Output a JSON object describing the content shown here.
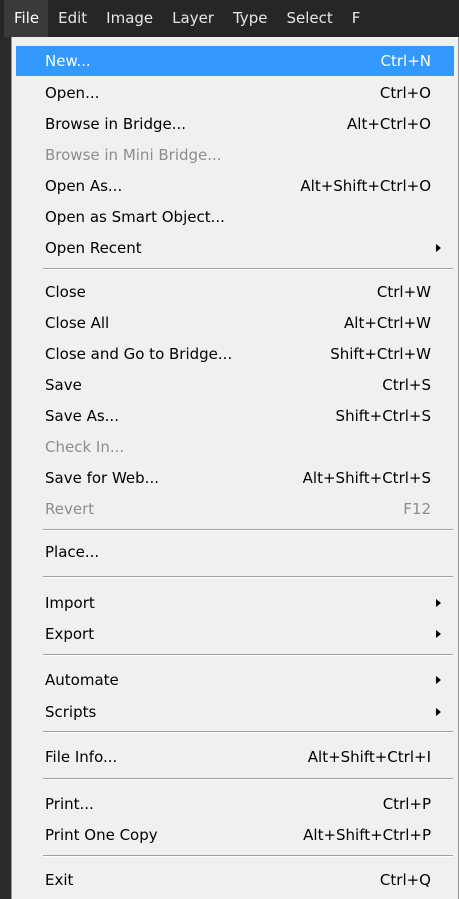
{
  "menubar": {
    "items": [
      {
        "label": "File",
        "active": true
      },
      {
        "label": "Edit"
      },
      {
        "label": "Image"
      },
      {
        "label": "Layer"
      },
      {
        "label": "Type"
      },
      {
        "label": "Select"
      },
      {
        "label": "F"
      }
    ]
  },
  "file_menu": {
    "new": {
      "label": "New...",
      "shortcut": "Ctrl+N"
    },
    "open": {
      "label": "Open...",
      "shortcut": "Ctrl+O"
    },
    "browse_bridge": {
      "label": "Browse in Bridge...",
      "shortcut": "Alt+Ctrl+O"
    },
    "browse_mini_bridge": {
      "label": "Browse in Mini Bridge...",
      "shortcut": ""
    },
    "open_as": {
      "label": "Open As...",
      "shortcut": "Alt+Shift+Ctrl+O"
    },
    "open_smart_object": {
      "label": "Open as Smart Object...",
      "shortcut": ""
    },
    "open_recent": {
      "label": "Open Recent",
      "shortcut": ""
    },
    "close": {
      "label": "Close",
      "shortcut": "Ctrl+W"
    },
    "close_all": {
      "label": "Close All",
      "shortcut": "Alt+Ctrl+W"
    },
    "close_go_bridge": {
      "label": "Close and Go to Bridge...",
      "shortcut": "Shift+Ctrl+W"
    },
    "save": {
      "label": "Save",
      "shortcut": "Ctrl+S"
    },
    "save_as": {
      "label": "Save As...",
      "shortcut": "Shift+Ctrl+S"
    },
    "check_in": {
      "label": "Check In...",
      "shortcut": ""
    },
    "save_for_web": {
      "label": "Save for Web...",
      "shortcut": "Alt+Shift+Ctrl+S"
    },
    "revert": {
      "label": "Revert",
      "shortcut": "F12"
    },
    "place": {
      "label": "Place...",
      "shortcut": ""
    },
    "import": {
      "label": "Import",
      "shortcut": ""
    },
    "export": {
      "label": "Export",
      "shortcut": ""
    },
    "automate": {
      "label": "Automate",
      "shortcut": ""
    },
    "scripts": {
      "label": "Scripts",
      "shortcut": ""
    },
    "file_info": {
      "label": "File Info...",
      "shortcut": "Alt+Shift+Ctrl+I"
    },
    "print": {
      "label": "Print...",
      "shortcut": "Ctrl+P"
    },
    "print_one_copy": {
      "label": "Print One Copy",
      "shortcut": "Alt+Shift+Ctrl+P"
    },
    "exit": {
      "label": "Exit",
      "shortcut": "Ctrl+Q"
    }
  },
  "colors": {
    "highlight": "#3399ff",
    "menu_bg": "#f0f0f0",
    "menubar_bg": "#262626",
    "disabled_text": "#8d8d8d"
  }
}
